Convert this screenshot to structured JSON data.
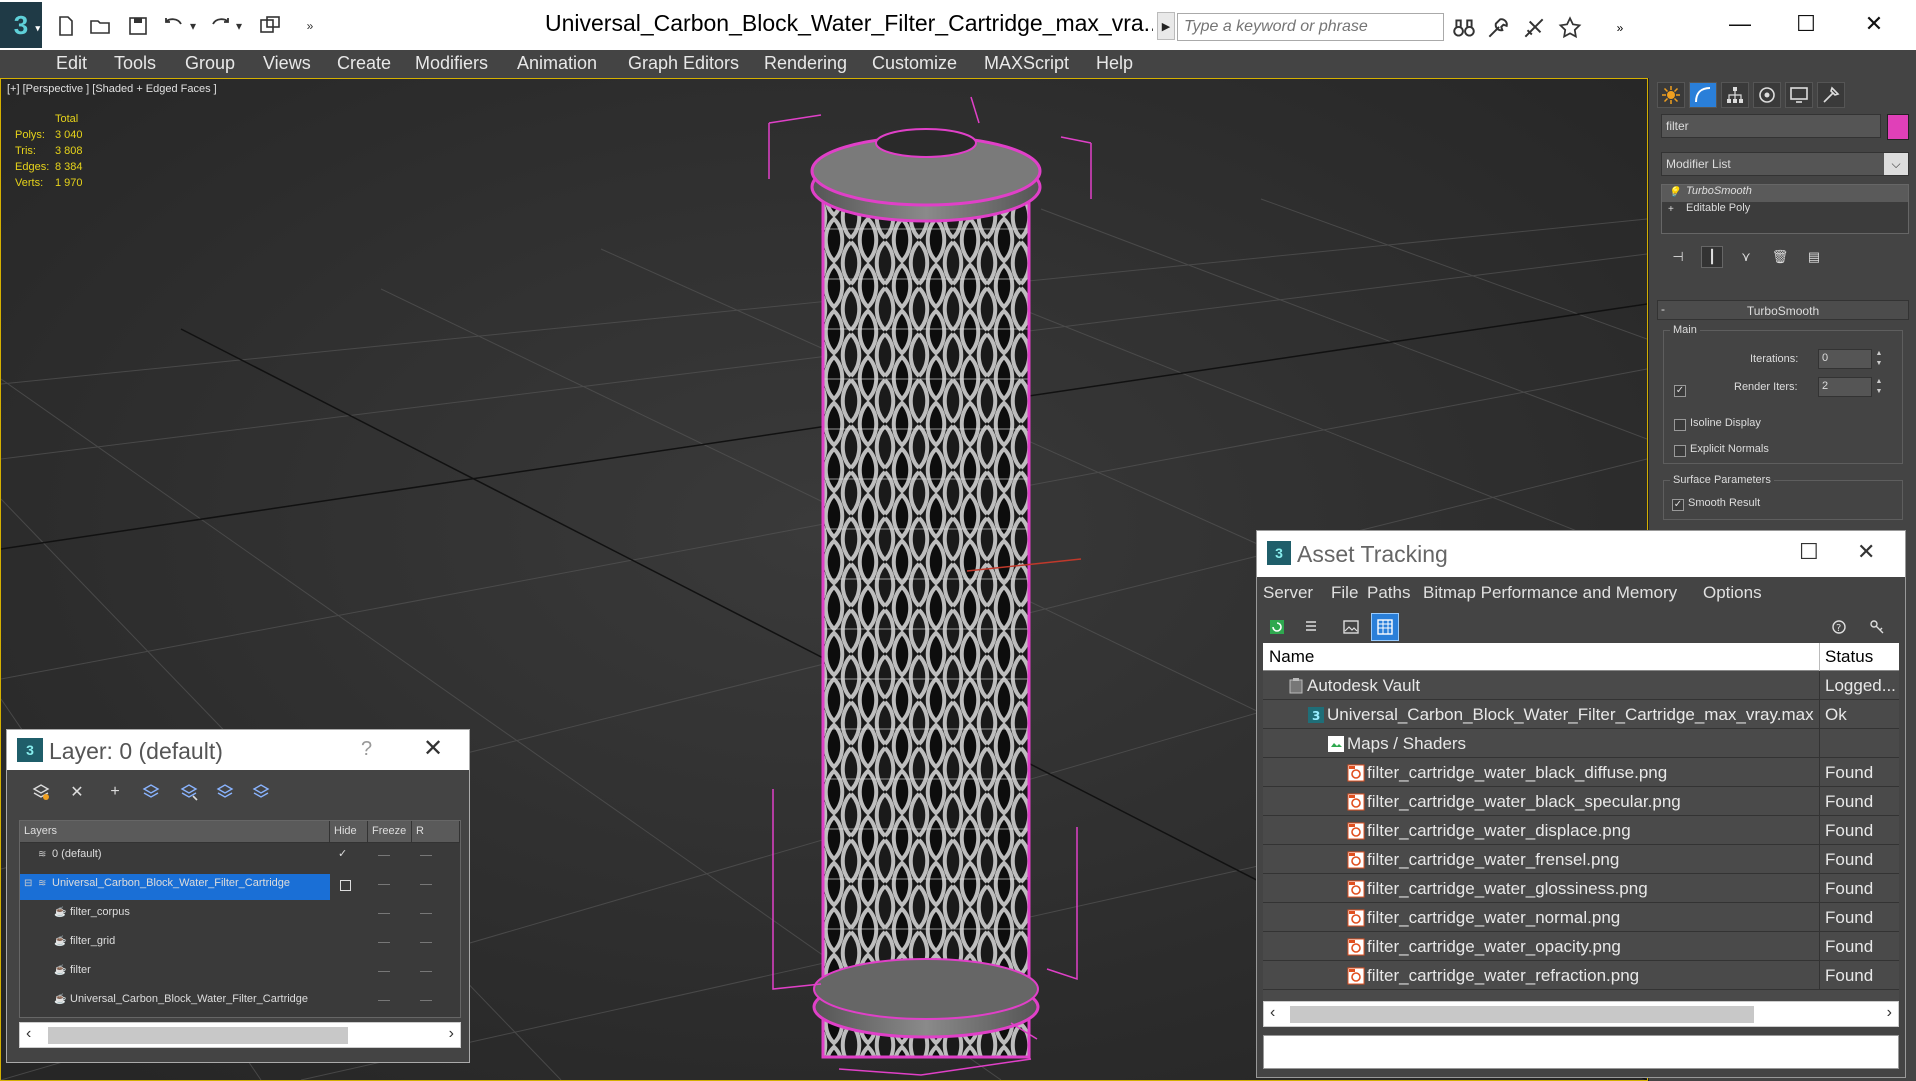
{
  "window": {
    "title": "Universal_Carbon_Block_Water_Filter_Cartridge_max_vra...",
    "search_placeholder": "Type a keyword or phrase",
    "minimize": "—",
    "maximize": "☐",
    "close": "✕"
  },
  "menu": [
    "Edit",
    "Tools",
    "Group",
    "Views",
    "Create",
    "Modifiers",
    "Animation",
    "Graph Editors",
    "Rendering",
    "Customize",
    "MAXScript",
    "Help"
  ],
  "viewport": {
    "label": "[+] [Perspective ] [Shaded + Edged Faces ]",
    "stats": {
      "header": "Total",
      "rows": [
        {
          "key": "Polys:",
          "value": "3 040"
        },
        {
          "key": "Tris:",
          "value": "3 808"
        },
        {
          "key": "Edges:",
          "value": "8 384"
        },
        {
          "key": "Verts:",
          "value": "1 970"
        }
      ]
    },
    "border_color": "#d4b000",
    "selection_color": "#e040c8"
  },
  "command_panel": {
    "object_name": "filter",
    "object_color": "#e040b8",
    "modifier_list": "Modifier List",
    "stack": [
      {
        "label": "TurboSmooth",
        "selected": true
      },
      {
        "label": "Editable Poly",
        "selected": false
      }
    ],
    "turbosmooth": {
      "title": "TurboSmooth",
      "main_group": "Main",
      "iterations_label": "Iterations:",
      "iterations_value": "0",
      "render_iters_label": "Render Iters:",
      "render_iters_value": "2",
      "render_iters_checked": true,
      "isoline_label": "Isoline Display",
      "isoline_checked": false,
      "explicit_normals_label": "Explicit Normals",
      "explicit_normals_checked": false,
      "surface_group": "Surface Parameters",
      "smooth_result_label": "Smooth Result",
      "smooth_result_checked": true
    }
  },
  "layer_window": {
    "title": "Layer: 0 (default)",
    "help": "?",
    "close": "✕",
    "columns": [
      "Layers",
      "Hide",
      "Freeze",
      "R"
    ],
    "rows": [
      {
        "name": "0 (default)",
        "indent": 0,
        "current": true,
        "selected": false
      },
      {
        "name": "Universal_Carbon_Block_Water_Filter_Cartridge",
        "indent": 0,
        "current": false,
        "selected": true
      },
      {
        "name": "filter_corpus",
        "indent": 1,
        "current": false,
        "selected": false
      },
      {
        "name": "filter_grid",
        "indent": 1,
        "current": false,
        "selected": false
      },
      {
        "name": "filter",
        "indent": 1,
        "current": false,
        "selected": false
      },
      {
        "name": "Universal_Carbon_Block_Water_Filter_Cartridge",
        "indent": 1,
        "current": false,
        "selected": false
      }
    ]
  },
  "asset_window": {
    "title": "Asset Tracking",
    "menu": [
      "Server",
      "File",
      "Paths",
      "Bitmap Performance and Memory",
      "Options"
    ],
    "columns": {
      "name": "Name",
      "status": "Status"
    },
    "rows": [
      {
        "name": "Autodesk Vault",
        "status": "Logged...",
        "indent": 1,
        "icon": "vault-icon"
      },
      {
        "name": "Universal_Carbon_Block_Water_Filter_Cartridge_max_vray.max",
        "status": "Ok",
        "indent": 2,
        "icon": "max-file-icon"
      },
      {
        "name": "Maps / Shaders",
        "status": "",
        "indent": 3,
        "icon": "maps-folder-icon"
      },
      {
        "name": "filter_cartridge_water_black_diffuse.png",
        "status": "Found",
        "indent": 4,
        "icon": "bitmap-icon"
      },
      {
        "name": "filter_cartridge_water_black_specular.png",
        "status": "Found",
        "indent": 4,
        "icon": "bitmap-icon"
      },
      {
        "name": "filter_cartridge_water_displace.png",
        "status": "Found",
        "indent": 4,
        "icon": "bitmap-icon"
      },
      {
        "name": "filter_cartridge_water_frensel.png",
        "status": "Found",
        "indent": 4,
        "icon": "bitmap-icon"
      },
      {
        "name": "filter_cartridge_water_glossiness.png",
        "status": "Found",
        "indent": 4,
        "icon": "bitmap-icon"
      },
      {
        "name": "filter_cartridge_water_normal.png",
        "status": "Found",
        "indent": 4,
        "icon": "bitmap-icon"
      },
      {
        "name": "filter_cartridge_water_opacity.png",
        "status": "Found",
        "indent": 4,
        "icon": "bitmap-icon"
      },
      {
        "name": "filter_cartridge_water_refraction.png",
        "status": "Found",
        "indent": 4,
        "icon": "bitmap-icon"
      }
    ]
  }
}
